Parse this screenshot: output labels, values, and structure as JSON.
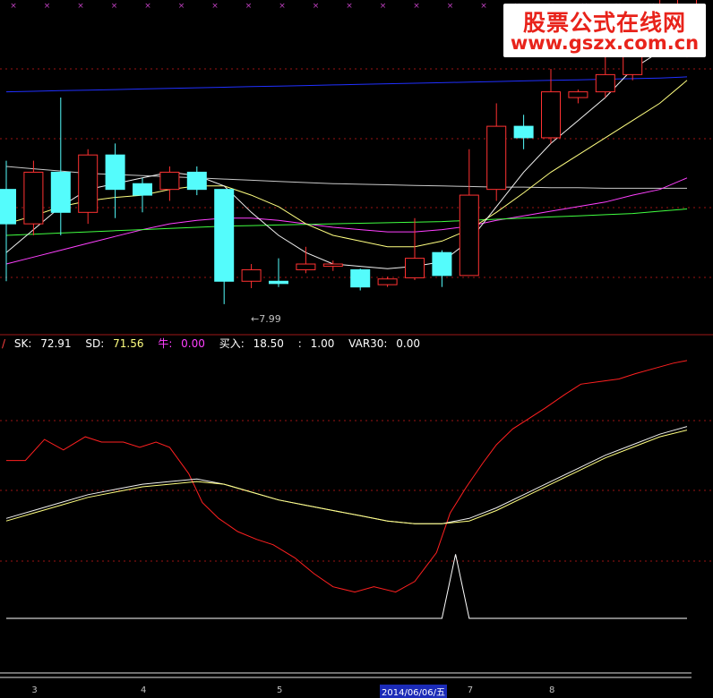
{
  "watermark": {
    "title": "股票公式在线网",
    "url": "www.gszx.com.cn"
  },
  "legend": {
    "prefix": "/",
    "items": [
      {
        "label": "SK: ",
        "value": "72.91",
        "color": "#ffffff"
      },
      {
        "label": "SD: ",
        "value": "71.56",
        "color": "#ffff80"
      },
      {
        "label": "牛: ",
        "value": "0.00",
        "color": "#ff40ff"
      },
      {
        "label": "买入: ",
        "value": "18.50",
        "color": "#ffffff"
      },
      {
        "label": ": ",
        "value": "1.00",
        "color": "#ffffff"
      },
      {
        "label": "VAR30: ",
        "value": "0.00",
        "color": "#ffffff"
      }
    ]
  },
  "low_label": "←7.99",
  "x_axis": {
    "month_ticks": [
      {
        "label": "3",
        "candle": 1
      },
      {
        "label": "4",
        "candle": 5
      },
      {
        "label": "5",
        "candle": 10
      },
      {
        "label": "7",
        "candle": 17
      },
      {
        "label": "8",
        "candle": 20
      }
    ],
    "highlight_date": "2014/06/06/五"
  },
  "chart_data": [
    {
      "type": "candlestick",
      "ylim": [
        7.6,
        10.5
      ],
      "colors": {
        "up": "#ff3232",
        "down": "#54fcfc"
      },
      "candles": [
        {
          "o": 8.85,
          "c": 8.55,
          "h": 9.1,
          "l": 8.05
        },
        {
          "o": 8.55,
          "c": 9.0,
          "h": 9.1,
          "l": 8.45
        },
        {
          "o": 9.0,
          "c": 8.65,
          "h": 9.65,
          "l": 8.45
        },
        {
          "o": 8.65,
          "c": 9.15,
          "h": 9.2,
          "l": 8.55
        },
        {
          "o": 9.15,
          "c": 8.85,
          "h": 9.25,
          "l": 8.6
        },
        {
          "o": 8.9,
          "c": 8.8,
          "h": 8.95,
          "l": 8.65
        },
        {
          "o": 8.85,
          "c": 9.0,
          "h": 9.05,
          "l": 8.75
        },
        {
          "o": 9.0,
          "c": 8.85,
          "h": 9.05,
          "l": 8.8
        },
        {
          "o": 8.85,
          "c": 8.05,
          "h": 8.85,
          "l": 7.85
        },
        {
          "o": 8.05,
          "c": 8.15,
          "h": 8.2,
          "l": 7.99
        },
        {
          "o": 8.05,
          "c": 8.03,
          "h": 8.25,
          "l": 8.0
        },
        {
          "o": 8.15,
          "c": 8.2,
          "h": 8.35,
          "l": 8.12
        },
        {
          "o": 8.18,
          "c": 8.2,
          "h": 8.23,
          "l": 8.14
        },
        {
          "o": 8.15,
          "c": 8.0,
          "h": 8.16,
          "l": 7.97
        },
        {
          "o": 8.02,
          "c": 8.07,
          "h": 8.09,
          "l": 8.0
        },
        {
          "o": 8.08,
          "c": 8.25,
          "h": 8.6,
          "l": 8.06
        },
        {
          "o": 8.3,
          "c": 8.1,
          "h": 8.32,
          "l": 8.0
        },
        {
          "o": 8.1,
          "c": 8.8,
          "h": 9.2,
          "l": 8.1
        },
        {
          "o": 8.85,
          "c": 9.4,
          "h": 9.6,
          "l": 8.75
        },
        {
          "o": 9.4,
          "c": 9.3,
          "h": 9.5,
          "l": 9.2
        },
        {
          "o": 9.3,
          "c": 9.7,
          "h": 9.9,
          "l": 9.25
        },
        {
          "o": 9.65,
          "c": 9.7,
          "h": 9.72,
          "l": 9.6
        },
        {
          "o": 9.7,
          "c": 9.85,
          "h": 10.1,
          "l": 9.65
        },
        {
          "o": 9.85,
          "c": 10.2,
          "h": 10.28,
          "l": 9.8
        },
        {
          "o": 10.2,
          "c": 10.35,
          "h": 10.5,
          "l": 10.1
        },
        {
          "o": 10.35,
          "c": 10.65,
          "h": 10.8,
          "l": 10.0
        }
      ],
      "series": [
        {
          "color": "#2030ff",
          "values": [
            9.7,
            9.705,
            9.71,
            9.715,
            9.72,
            9.725,
            9.73,
            9.735,
            9.74,
            9.745,
            9.75,
            9.755,
            9.76,
            9.765,
            9.77,
            9.775,
            9.78,
            9.785,
            9.79,
            9.795,
            9.8,
            9.805,
            9.81,
            9.815,
            9.82,
            9.83
          ]
        },
        {
          "color": "#c8c8c8",
          "values": [
            9.05,
            9.03,
            9.01,
            8.99,
            8.98,
            8.97,
            8.96,
            8.95,
            8.94,
            8.93,
            8.92,
            8.91,
            8.9,
            8.895,
            8.89,
            8.885,
            8.88,
            8.875,
            8.87,
            8.87,
            8.865,
            8.865,
            8.86,
            8.86,
            8.86,
            8.86
          ]
        },
        {
          "color": "#ff40ff",
          "values": [
            8.2,
            8.26,
            8.32,
            8.38,
            8.44,
            8.5,
            8.55,
            8.58,
            8.6,
            8.6,
            8.58,
            8.55,
            8.52,
            8.5,
            8.48,
            8.48,
            8.5,
            8.53,
            8.58,
            8.62,
            8.66,
            8.7,
            8.74,
            8.8,
            8.85,
            8.95
          ]
        },
        {
          "color": "#40ff40",
          "values": [
            8.45,
            8.46,
            8.47,
            8.48,
            8.49,
            8.5,
            8.51,
            8.52,
            8.53,
            8.535,
            8.54,
            8.545,
            8.55,
            8.555,
            8.56,
            8.565,
            8.57,
            8.58,
            8.59,
            8.6,
            8.61,
            8.62,
            8.63,
            8.64,
            8.66,
            8.68
          ]
        },
        {
          "color": "#ffff80",
          "values": [
            8.55,
            8.62,
            8.7,
            8.75,
            8.78,
            8.8,
            8.85,
            8.88,
            8.88,
            8.8,
            8.7,
            8.55,
            8.45,
            8.4,
            8.35,
            8.35,
            8.4,
            8.5,
            8.65,
            8.82,
            9.0,
            9.15,
            9.3,
            9.45,
            9.6,
            9.8
          ]
        },
        {
          "color": "#f0f0f0",
          "values": [
            8.3,
            8.5,
            8.7,
            8.85,
            8.9,
            8.95,
            9.0,
            8.97,
            8.88,
            8.65,
            8.45,
            8.3,
            8.2,
            8.18,
            8.16,
            8.18,
            8.22,
            8.4,
            8.7,
            9.0,
            9.25,
            9.45,
            9.65,
            9.9,
            10.05,
            10.3
          ]
        }
      ]
    },
    {
      "type": "line",
      "ylim": [
        0,
        100
      ],
      "series": [
        {
          "color": "#ff2020",
          "x": [
            0,
            0.7,
            1.4,
            2.1,
            2.9,
            3.5,
            4.3,
            4.9,
            5.5,
            6.0,
            6.7,
            7.2,
            7.8,
            8.5,
            9.2,
            9.8,
            10.6,
            11.3,
            12.0,
            12.8,
            13.5,
            14.3,
            15.0,
            15.8,
            16.3,
            16.9,
            17.5,
            18.0,
            18.6,
            19.2,
            19.8,
            20.5,
            21.1,
            21.8,
            22.5,
            23.1,
            23.8,
            24.5,
            25.0
          ],
          "values": [
            60,
            60,
            68,
            64,
            69,
            67,
            67,
            65,
            67,
            65,
            55,
            44,
            38,
            33,
            30,
            28,
            23,
            17,
            12,
            10,
            12,
            10,
            14,
            25,
            40,
            50,
            59,
            66,
            72,
            76,
            80,
            85,
            89,
            90,
            91,
            93,
            95,
            97,
            98
          ]
        },
        {
          "color": "#f0f0f0",
          "x": [
            0,
            1,
            2,
            3,
            4,
            5,
            6,
            7,
            8,
            9,
            10,
            11,
            12,
            13,
            14,
            15,
            16,
            17,
            18,
            19,
            20,
            21,
            22,
            23,
            24,
            25
          ],
          "values": [
            38,
            41,
            44,
            47,
            49,
            51,
            52,
            53,
            51,
            48,
            45,
            43,
            41,
            39,
            37,
            36,
            36,
            38,
            42,
            47,
            52,
            57,
            62,
            66,
            70,
            72.91
          ]
        },
        {
          "color": "#ffff80",
          "x": [
            0,
            1,
            2,
            3,
            4,
            5,
            6,
            7,
            8,
            9,
            10,
            11,
            12,
            13,
            14,
            15,
            16,
            17,
            18,
            19,
            20,
            21,
            22,
            23,
            24,
            25
          ],
          "values": [
            37,
            40,
            43,
            46,
            48,
            50,
            51,
            52,
            51,
            48,
            45,
            43,
            41,
            39,
            37,
            36,
            36,
            37,
            41,
            46,
            51,
            56,
            61,
            65,
            69,
            71.56
          ]
        },
        {
          "color": "#ffffff",
          "x": [
            0,
            16,
            16.5,
            17,
            17.5,
            25
          ],
          "values": [
            0,
            0,
            24.36,
            0,
            0,
            0
          ]
        }
      ]
    }
  ]
}
